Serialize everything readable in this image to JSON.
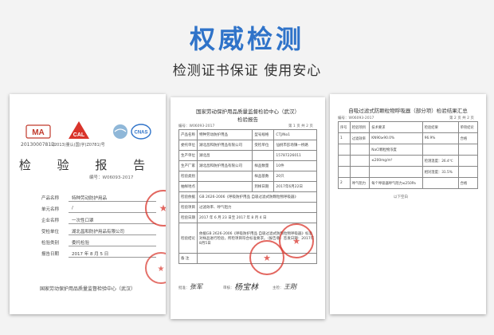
{
  "header": {
    "title": "权威检测",
    "subtitle": "检测证书保证 使用安心"
  },
  "colors": {
    "title": "#2f73c9",
    "stamp": "#d9342b",
    "background": "#f3f3f3"
  },
  "certificate_cover": {
    "logos": [
      "MA",
      "CAL",
      "ilac-MRA",
      "CNAS"
    ],
    "ma_subtext": "2013000781D",
    "cal_subtext": "(2013)量认(国)字(Z0781)号",
    "title": "检 验 报 告",
    "report_no": "编号：W06093-2017",
    "fields": [
      {
        "label": "产品名称",
        "value": "特种劳动防护用品"
      },
      {
        "label": "单元名称",
        "value": "/"
      },
      {
        "label": "企业名称",
        "value": "一次性口罩"
      },
      {
        "label": "受检单位",
        "value": "湖北昌和防护用品有限公司"
      },
      {
        "label": "检验类别",
        "value": "委托检验"
      },
      {
        "label": "报告日期",
        "value": "2017 年 8 月 5 日"
      }
    ],
    "footer": "国家劳动保护用品质量监督检验中心（武汉）"
  },
  "report_page": {
    "org": "国家劳动保护用品质量监督检验中心（武汉）",
    "subtitle": "检验报告",
    "report_no": "编号：W06093-2017",
    "page": "第 1 页 共 2 页",
    "rows": [
      [
        "产品名称",
        "特种劳动防护用品",
        "型号规格",
        "CTJ/No1"
      ],
      [
        "委托单位",
        "湖北昌和防护用品有限公司",
        "受检单位",
        "仙桃市彭场镇一桥路"
      ],
      [
        "生产单位",
        "湖北昌",
        "",
        "15787226011"
      ],
      [
        "生产厂家",
        "湖北昌和防护用品有限公司",
        "样品数量",
        "10件"
      ],
      [
        "检验类别",
        "",
        "样品基数",
        "20只"
      ],
      [
        "抽样地点",
        "",
        "到样日期",
        "2017年6月22日"
      ],
      [
        "检验依据",
        "GB 2626-2006《呼吸防护用品  自吸过滤式防颗粒物呼吸器》",
        "",
        ""
      ],
      [
        "检验项目",
        "过滤效率、呼气阻力",
        "",
        ""
      ],
      [
        "检验日期",
        "2017 年 6 月 23 日至 2017 年 8 月 4 日",
        "",
        ""
      ],
      [
        "检验结论",
        "依据GB 2626-2006《呼吸防护用品  自吸过滤式防颗粒物呼吸器》标准对样品进行检验，所检项目符合标准要求。（报告章）签发日期：2017年8月5日",
        "",
        ""
      ],
      [
        "备 注",
        "",
        "",
        ""
      ]
    ],
    "sign_labels": [
      "批准：",
      "审核：",
      "主检："
    ],
    "signatures": [
      "张军",
      "杨宝林",
      "王刚"
    ]
  },
  "results_page": {
    "title": "自吸过滤式防颗粒物呼吸器（部分项）检验结果汇总",
    "report_no": "编号：W06093-2017",
    "page": "第 2 页 共 2 页",
    "header": [
      "序号",
      "检验项目",
      "技术要求",
      "检验结果",
      "单项结论"
    ],
    "rows": [
      [
        "1",
        "过滤效率",
        "KN90≥90.0%",
        "96.9%",
        "合格"
      ],
      [
        "",
        "",
        "NaCl颗粒物浓度",
        "",
        ""
      ],
      [
        "",
        "",
        "≤200mg/m³",
        "检测温度：26.4℃",
        ""
      ],
      [
        "",
        "",
        "",
        "相对湿度：31.5%",
        ""
      ],
      [
        "2",
        "呼气阻力",
        "每个呼吸器呼气阻力≤250Pa",
        "",
        "合格"
      ]
    ],
    "footer_note": "以下空白"
  }
}
